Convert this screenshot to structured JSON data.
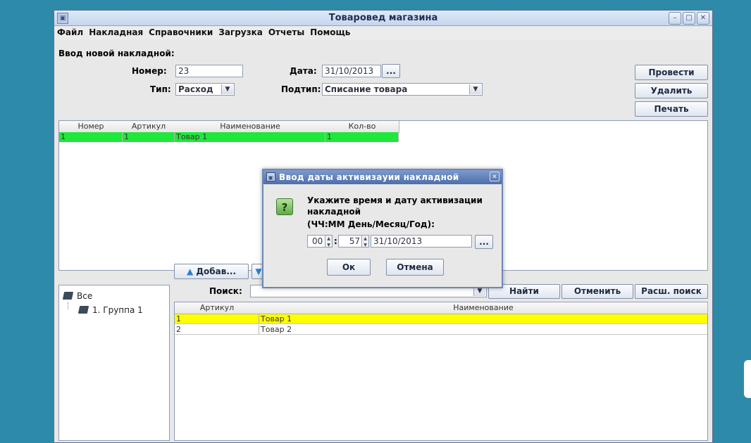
{
  "window": {
    "title": "Товаровед магазина",
    "icon": "app-icon",
    "buttons": [
      "minimize-icon",
      "maximize-icon",
      "close-icon"
    ]
  },
  "menu": [
    "Файл",
    "Накладная",
    "Справочники",
    "Загрузка",
    "Отчеты",
    "Помощь"
  ],
  "form": {
    "section_title": "Ввод новой накладной:",
    "number_label": "Номер:",
    "number_value": "23",
    "date_label": "Дата:",
    "date_value": "31/10/2013",
    "date_button": "...",
    "type_label": "Тип:",
    "type_value": "Расход",
    "subtype_label": "Подтип:",
    "subtype_value": "Списание товара"
  },
  "actions": {
    "post": "Провести",
    "delete": "Удалить",
    "print": "Печать"
  },
  "invoice_table": {
    "headers": [
      "Номер",
      "Артикул",
      "Наименование",
      "Кол-во"
    ],
    "rows": [
      {
        "num": "1",
        "article": "1",
        "name": "Товар 1",
        "qty": "1",
        "highlight": "#1ee83a"
      }
    ]
  },
  "add_button": "Добав...",
  "tree": {
    "root": "Все",
    "child": "1. Группа 1"
  },
  "search": {
    "label": "Поиск:",
    "value": "",
    "find": "Найти",
    "cancel": "Отменить",
    "advanced": "Расш. поиск"
  },
  "goods_table": {
    "headers": [
      "Артикул",
      "Наименование"
    ],
    "rows": [
      {
        "article": "1",
        "name": "Товар 1",
        "highlight": "#ffff00"
      },
      {
        "article": "2",
        "name": "Товар 2"
      }
    ]
  },
  "dialog": {
    "title": "Ввод даты активизауии накладной",
    "icon": "question-icon",
    "message_line1": "Укажите время и дату активизации",
    "message_line2": "накладной",
    "message_line3": "(ЧЧ:ММ  День/Месяц/Год):",
    "hours": "00",
    "minutes": "57",
    "date": "31/10/2013",
    "date_button": "...",
    "ok": "Ок",
    "cancel": "Отмена"
  },
  "colors": {
    "desktop": "#2e8aa9",
    "selected_invoice_row": "#1ee83a",
    "selected_goods_row": "#ffff00"
  }
}
